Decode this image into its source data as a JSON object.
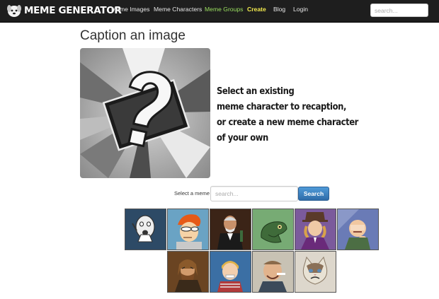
{
  "app": {
    "name": "MEME GENERATOR"
  },
  "nav": {
    "links": [
      {
        "label": "Meme Images"
      },
      {
        "label": "Meme Characters"
      },
      {
        "label": "Meme Groups",
        "color": "#9be060"
      },
      {
        "label": "Create",
        "color": "#f2e94e"
      },
      {
        "label": "Blog"
      },
      {
        "label": "Login"
      }
    ],
    "search_placeholder": "search..."
  },
  "page": {
    "title": "Caption an image",
    "prompt_lines": [
      "Select an existing",
      "meme character to recaption,",
      "or create a new meme character",
      "of your own"
    ]
  },
  "meme_search": {
    "label": "Select a meme",
    "placeholder": "search...",
    "button": "Search"
  },
  "thumbnails": {
    "row1": [
      "y-u-no-guy",
      "fry-not-sure",
      "most-interesting-man",
      "philosoraptor",
      "condescending-wonka",
      "success-kid"
    ],
    "row2": [
      "one-does-not-simply",
      "bad-luck-brian",
      "good-guy-greg",
      "grumpy-cat"
    ]
  },
  "colors": {
    "navbar": "#1e1e1e",
    "search_button": "#3a7cc0",
    "create_link": "#f2e94e",
    "groups_link": "#9be060"
  }
}
